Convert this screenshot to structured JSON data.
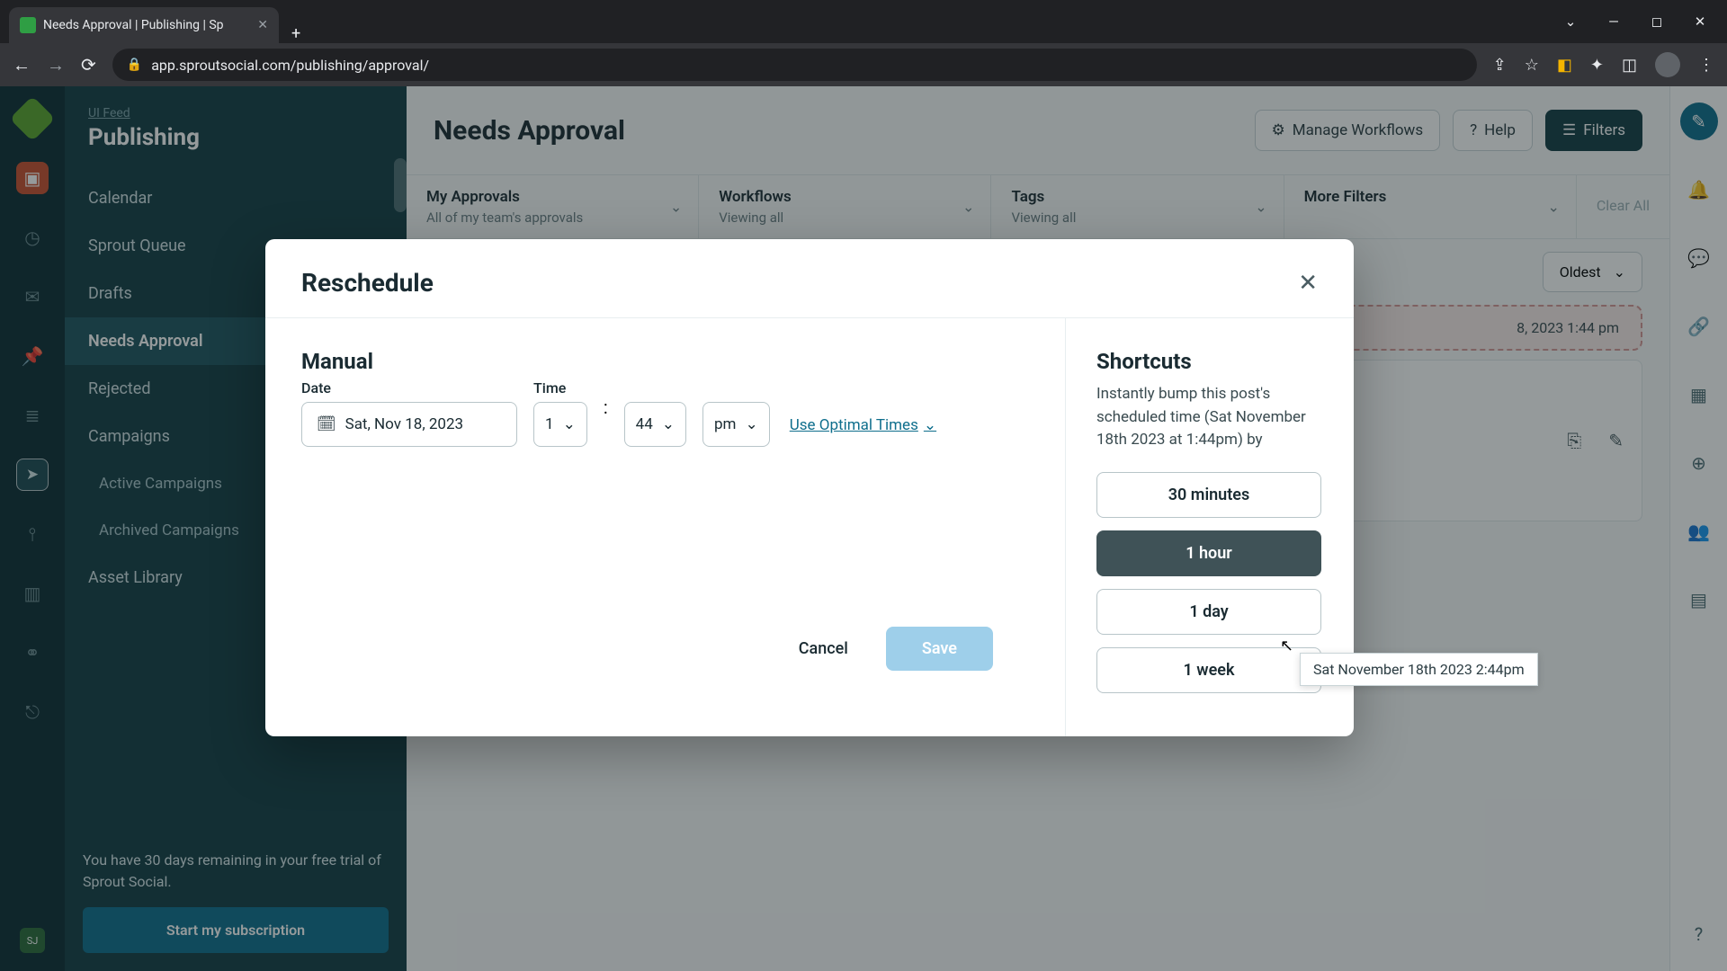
{
  "browser": {
    "tab_title": "Needs Approval | Publishing | Sp",
    "url": "app.sproutsocial.com/publishing/approval/"
  },
  "sidebar": {
    "crumb": "UI Feed",
    "title": "Publishing",
    "items": [
      {
        "label": "Calendar"
      },
      {
        "label": "Sprout Queue"
      },
      {
        "label": "Drafts"
      },
      {
        "label": "Needs Approval"
      },
      {
        "label": "Rejected"
      },
      {
        "label": "Campaigns"
      },
      {
        "label": "Active Campaigns"
      },
      {
        "label": "Archived Campaigns"
      },
      {
        "label": "Asset Library"
      }
    ],
    "trial_text": "You have 30 days remaining in your free trial of Sprout Social.",
    "trial_button": "Start my subscription",
    "rail_badge": "SJ"
  },
  "header": {
    "page_title": "Needs Approval",
    "manage_workflows": "Manage Workflows",
    "help": "Help",
    "filters": "Filters"
  },
  "filters": {
    "approvals": {
      "label": "My Approvals",
      "sub": "All of my team's approvals"
    },
    "workflows": {
      "label": "Workflows",
      "sub": "Viewing all"
    },
    "tags": {
      "label": "Tags",
      "sub": "Viewing all"
    },
    "more": {
      "label": "More Filters"
    },
    "clear": "Clear All",
    "sort": "Oldest"
  },
  "post": {
    "scheduled": "8, 2023 1:44 pm"
  },
  "modal": {
    "title": "Reschedule",
    "manual_title": "Manual",
    "date_label": "Date",
    "date_value": "Sat, Nov 18, 2023",
    "time_label": "Time",
    "hour": "1",
    "minute": "44",
    "ampm": "pm",
    "optimal": "Use Optimal Times",
    "shortcuts_title": "Shortcuts",
    "shortcuts_desc": "Instantly bump this post's scheduled time (Sat November 18th 2023 at 1:44pm) by",
    "shortcut_30m": "30 minutes",
    "shortcut_1h": "1 hour",
    "shortcut_1d": "1 day",
    "shortcut_1w": "1 week",
    "tooltip": "Sat November 18th 2023 2:44pm",
    "cancel": "Cancel",
    "save": "Save"
  }
}
